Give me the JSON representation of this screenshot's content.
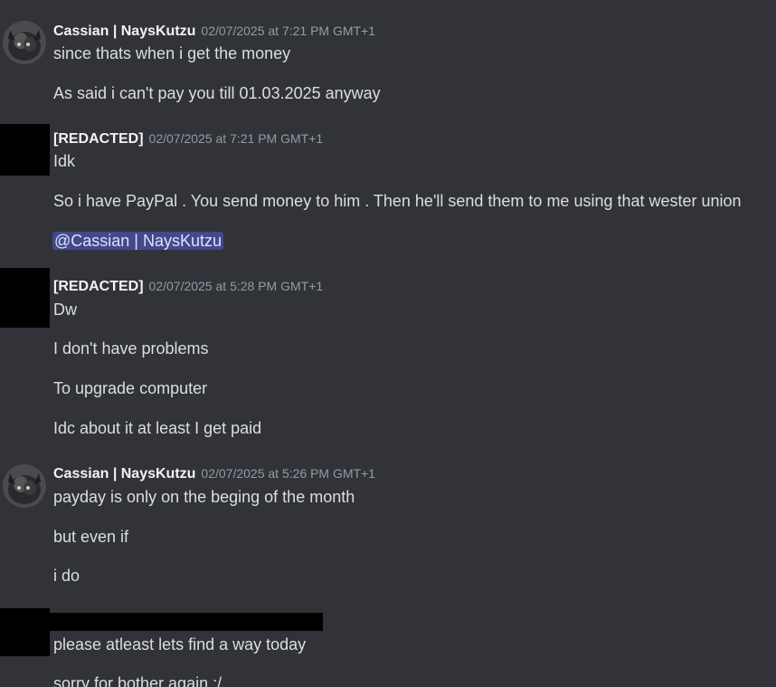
{
  "colors": {
    "background": "#313338",
    "username": "#f2f3f5",
    "timestamp": "#949ba4",
    "message_text": "#dbdee1",
    "mention_bg": "#5865f2"
  },
  "messages": [
    {
      "username": "Cassian | NaysKutzu",
      "timestamp": "02/07/2025 at 7:21 PM GMT+1",
      "avatar_icon": "cat-avatar-icon",
      "lines": [
        "since thats when i get the money",
        "As said i can't pay you till 01.03.2025 anyway"
      ]
    },
    {
      "username": "[REDACTED]",
      "timestamp": "02/07/2025 at 7:21 PM GMT+1",
      "avatar_icon": "redacted-avatar",
      "lines": [
        "Idk",
        "So i have PayPal . You send money to him . Then he'll send them to me using that wester union"
      ],
      "mention": "@Cassian | NaysKutzu"
    },
    {
      "username": "[REDACTED]",
      "timestamp": "02/07/2025 at 5:28 PM GMT+1",
      "avatar_icon": "redacted-avatar",
      "lines": [
        "Dw",
        "I don't have problems",
        "To upgrade computer",
        "Idc about it at least I get paid"
      ]
    },
    {
      "username": "Cassian | NaysKutzu",
      "timestamp": "02/07/2025 at 5:26 PM GMT+1",
      "avatar_icon": "cat-avatar-icon",
      "lines": [
        "payday is only on the beging of the month",
        "but even if",
        "i do"
      ]
    },
    {
      "username": "",
      "timestamp": "",
      "avatar_icon": "redacted-avatar",
      "lines": [
        "please atleast lets find a way today",
        "sorry for bother again :/"
      ]
    }
  ]
}
